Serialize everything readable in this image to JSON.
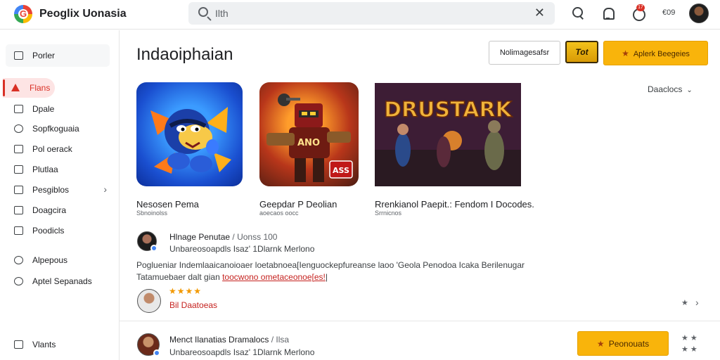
{
  "app": {
    "name": "Peoglix Uonasia",
    "logo_letter": "G"
  },
  "search": {
    "value": "Ilth",
    "placeholder": ""
  },
  "header": {
    "notification_count": "17",
    "counter_text": "€09"
  },
  "sidebar": {
    "items": [
      {
        "label": "Porler"
      },
      {
        "label": "Flans"
      },
      {
        "label": "Dpale"
      },
      {
        "label": "Sopfkoguaia"
      },
      {
        "label": "Pol oerack"
      },
      {
        "label": "Plutlaa"
      },
      {
        "label": "Pesgiblos"
      },
      {
        "label": "Doagcira"
      },
      {
        "label": "Poodicls"
      },
      {
        "label": "Alpepous"
      },
      {
        "label": "Aptel Sepanads"
      },
      {
        "label": "Vlants"
      }
    ]
  },
  "main": {
    "title": "Indaoiphaian",
    "buttons": {
      "outline": "Nolimagesafsr",
      "badge": "Tot",
      "primary": "Aplerk Beegeies"
    },
    "sort_label": "Daaclocs",
    "cards": [
      {
        "title": "Nesosen Pema",
        "sub": "Sbnoinolss"
      },
      {
        "title": "Geepdar P Deolian",
        "sub": "aoecaos oocc"
      },
      {
        "title": "Rrenkianol Paepit.: Fendom I Docodes.",
        "sub": "Srrnicnos",
        "banner_text": "DRUSTARK"
      }
    ],
    "badge_on_card2": "ASS",
    "art_text_card2": "ANO"
  },
  "reviews": [
    {
      "name": "Hlnage Penutae",
      "name_suffix": "/ Uonss 100",
      "meta": "Unbareosoapdls Isaz' 1Dlarnk Merlono",
      "body_line1": "Poglueniar Indemlaaicanoioaer loetabnoea[Ienguockepfureanse laoo 'Geola Penodoa Icaka Berilenugar",
      "body_line2_prefix": "Tatamuebaer dalt gian ",
      "body_link": "toocwono ometaceonoe[es!",
      "body_line2_suffix": "|"
    },
    {
      "stars": "★★★★",
      "rating_text": "Bil Daatoeas"
    },
    {
      "name": "Menct Ilanatias Dramalocs",
      "name_suffix": "/ Ilsa",
      "meta": "Unbareosoapdls Isaz' 1Dlarnk Merlono",
      "button": "Peonouats"
    }
  ],
  "colors": {
    "accent": "#f9b40b",
    "active": "#d93025",
    "link": "#c5221f"
  }
}
